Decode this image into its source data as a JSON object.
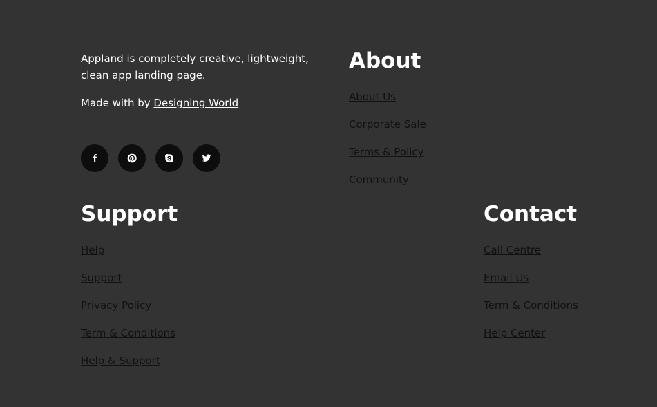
{
  "brand": {
    "description": "Appland is completely creative, lightweight, clean app landing page.",
    "made_with_prefix": "Made with by ",
    "made_with_link": "Designing World"
  },
  "social": [
    {
      "name": "facebook",
      "icon": "facebook-icon"
    },
    {
      "name": "pinterest",
      "icon": "pinterest-icon"
    },
    {
      "name": "skype",
      "icon": "skype-icon"
    },
    {
      "name": "twitter",
      "icon": "twitter-icon"
    }
  ],
  "columns": {
    "about": {
      "title": "About",
      "links": [
        "About Us",
        "Corporate Sale",
        "Terms & Policy",
        "Community"
      ]
    },
    "support": {
      "title": "Support",
      "links": [
        "Help",
        "Support",
        "Privacy Policy",
        "Term & Conditions",
        "Help & Support"
      ]
    },
    "contact": {
      "title": "Contact",
      "links": [
        "Call Centre",
        "Email Us",
        "Term & Conditions",
        "Help Center"
      ]
    }
  },
  "colors": {
    "background": "#333333",
    "social_button": "#0d0d0d",
    "link": "#111111",
    "heading": "#ffffff"
  }
}
